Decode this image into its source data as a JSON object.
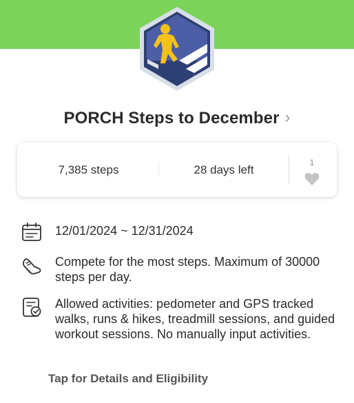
{
  "colors": {
    "header_band": "#7bd35a",
    "badge_border": "#d9dfe8",
    "badge_bg": "#2e3f73",
    "badge_sky": "#5a6bb0",
    "runner": "#f6c21a",
    "stripes": "#ffffff"
  },
  "badge": {
    "icon": "runner-hexagon-badge"
  },
  "challenge": {
    "title": "PORCH Steps to December"
  },
  "stats": {
    "steps": "7,385 steps",
    "days_left": "28 days left",
    "like_count": "1"
  },
  "info": {
    "date_range": "12/01/2024 ~ 12/31/2024",
    "goal": "Compete for the most steps. Maximum of 30000 steps per day.",
    "allowed": "Allowed activities: pedometer and GPS tracked walks, runs & hikes, treadmill sessions, and guided workout sessions. No manually input activities."
  },
  "footer": {
    "details_link": "Tap for Details and Eligibility"
  }
}
